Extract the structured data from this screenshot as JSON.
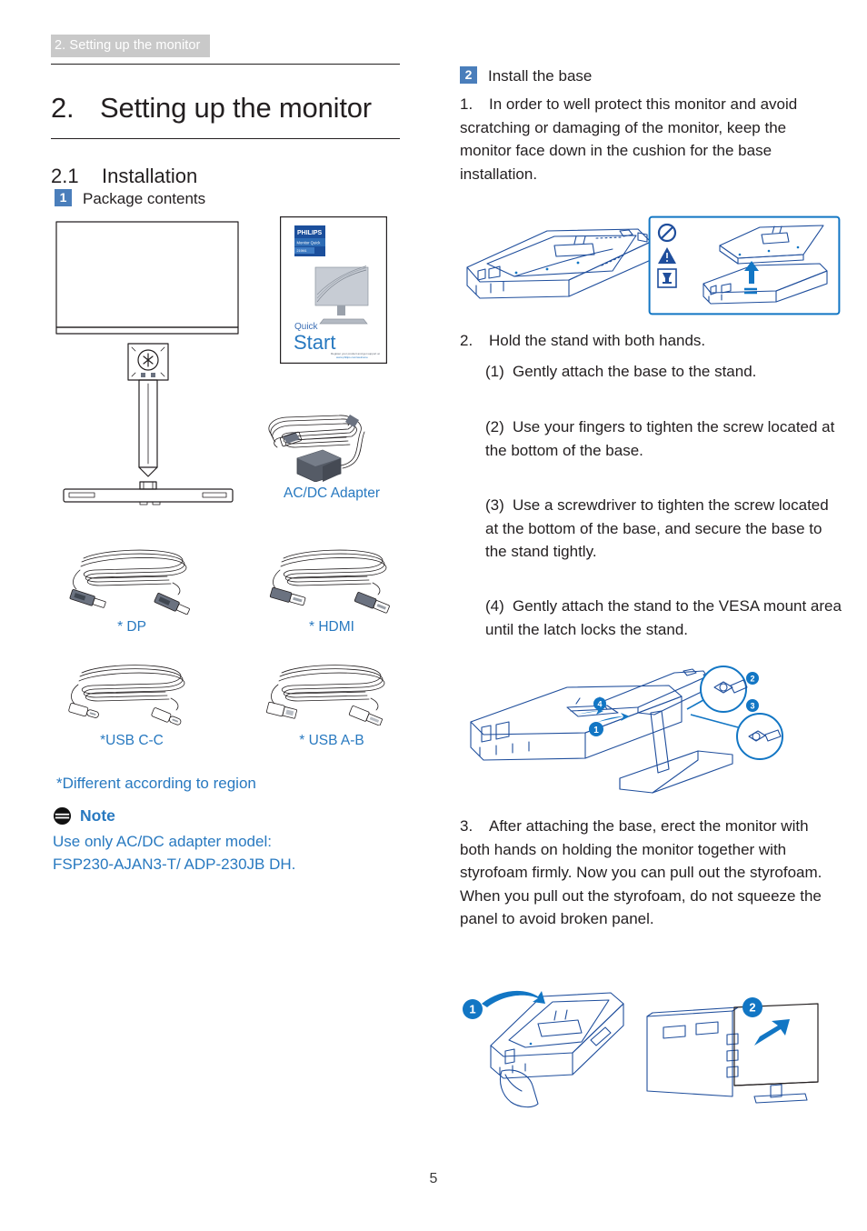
{
  "header": {
    "running_header": "2. Setting up the monitor",
    "chapter_number": "2.",
    "chapter_title": "Setting up the monitor",
    "section_number": "2.1",
    "section_title": "Installation"
  },
  "colors": {
    "accent_blue": "#2879c0",
    "badge_blue": "#4a7ebb",
    "header_gray": "#c9c9c9",
    "illustration_blue": "#1276c4",
    "text": "#231f20"
  },
  "left_column": {
    "badge": "1",
    "heading": "Package contents",
    "illustration_labels": {
      "quick_start_brand": "PHILIPS",
      "quick_start_word_quick": "Quick",
      "quick_start_word_start": "Start",
      "quick_start_footer_1": "Register your product and get support at",
      "quick_start_footer_2": "www.philips.com/welcome"
    },
    "items": [
      {
        "name": "ac-dc-adapter",
        "label": "AC/DC Adapter"
      },
      {
        "name": "dp-cable",
        "label": "* DP"
      },
      {
        "name": "hdmi-cable",
        "label": "* HDMI"
      },
      {
        "name": "usb-c-c-cable",
        "label": "*USB C-C"
      },
      {
        "name": "usb-a-b-cable",
        "label": "* USB A-B"
      }
    ],
    "region_note": "*Different according to region",
    "note": {
      "title": "Note",
      "icon": "note-icon",
      "body_line_1": "Use only AC/DC adapter model:",
      "body_line_2": "FSP230-AJAN3-T/ ADP-230JB DH."
    }
  },
  "right_column": {
    "badge": "2",
    "heading": "Install the base",
    "steps": [
      {
        "number": "1.",
        "text": "In order to well protect this monitor and avoid scratching or damaging of the monitor, keep the monitor face down in the cushion for the base installation."
      },
      {
        "number": "2.",
        "text": "Hold the stand with both hands."
      },
      {
        "number": "3.",
        "text": "After attaching the base, erect the monitor with both hands on holding the monitor together with styrofoam firmly. Now you can pull out the styrofoam. When you pull out the styrofoam, do not squeeze the panel to avoid broken panel."
      }
    ],
    "substeps": [
      {
        "number": "(1)",
        "text": "Gently attach the base to the stand."
      },
      {
        "number": "(2)",
        "text": "Use your fingers to tighten the screw located at the bottom of the base."
      },
      {
        "number": "(3)",
        "text": "Use a screwdriver to tighten the screw located at the bottom of the base, and secure the base to the stand tightly."
      },
      {
        "number": "(4)",
        "text": "Gently attach the stand to the VESA mount area until the latch locks the stand."
      }
    ],
    "diagram_callouts": {
      "cushion_warning_icons": [
        "prohibition-icon",
        "warning-triangle-icon",
        "fragile-glass-icon"
      ],
      "stand_callouts": [
        "1",
        "2",
        "3",
        "4"
      ],
      "erect_callouts": [
        "1",
        "2"
      ]
    }
  },
  "footer": {
    "page_number": "5"
  }
}
